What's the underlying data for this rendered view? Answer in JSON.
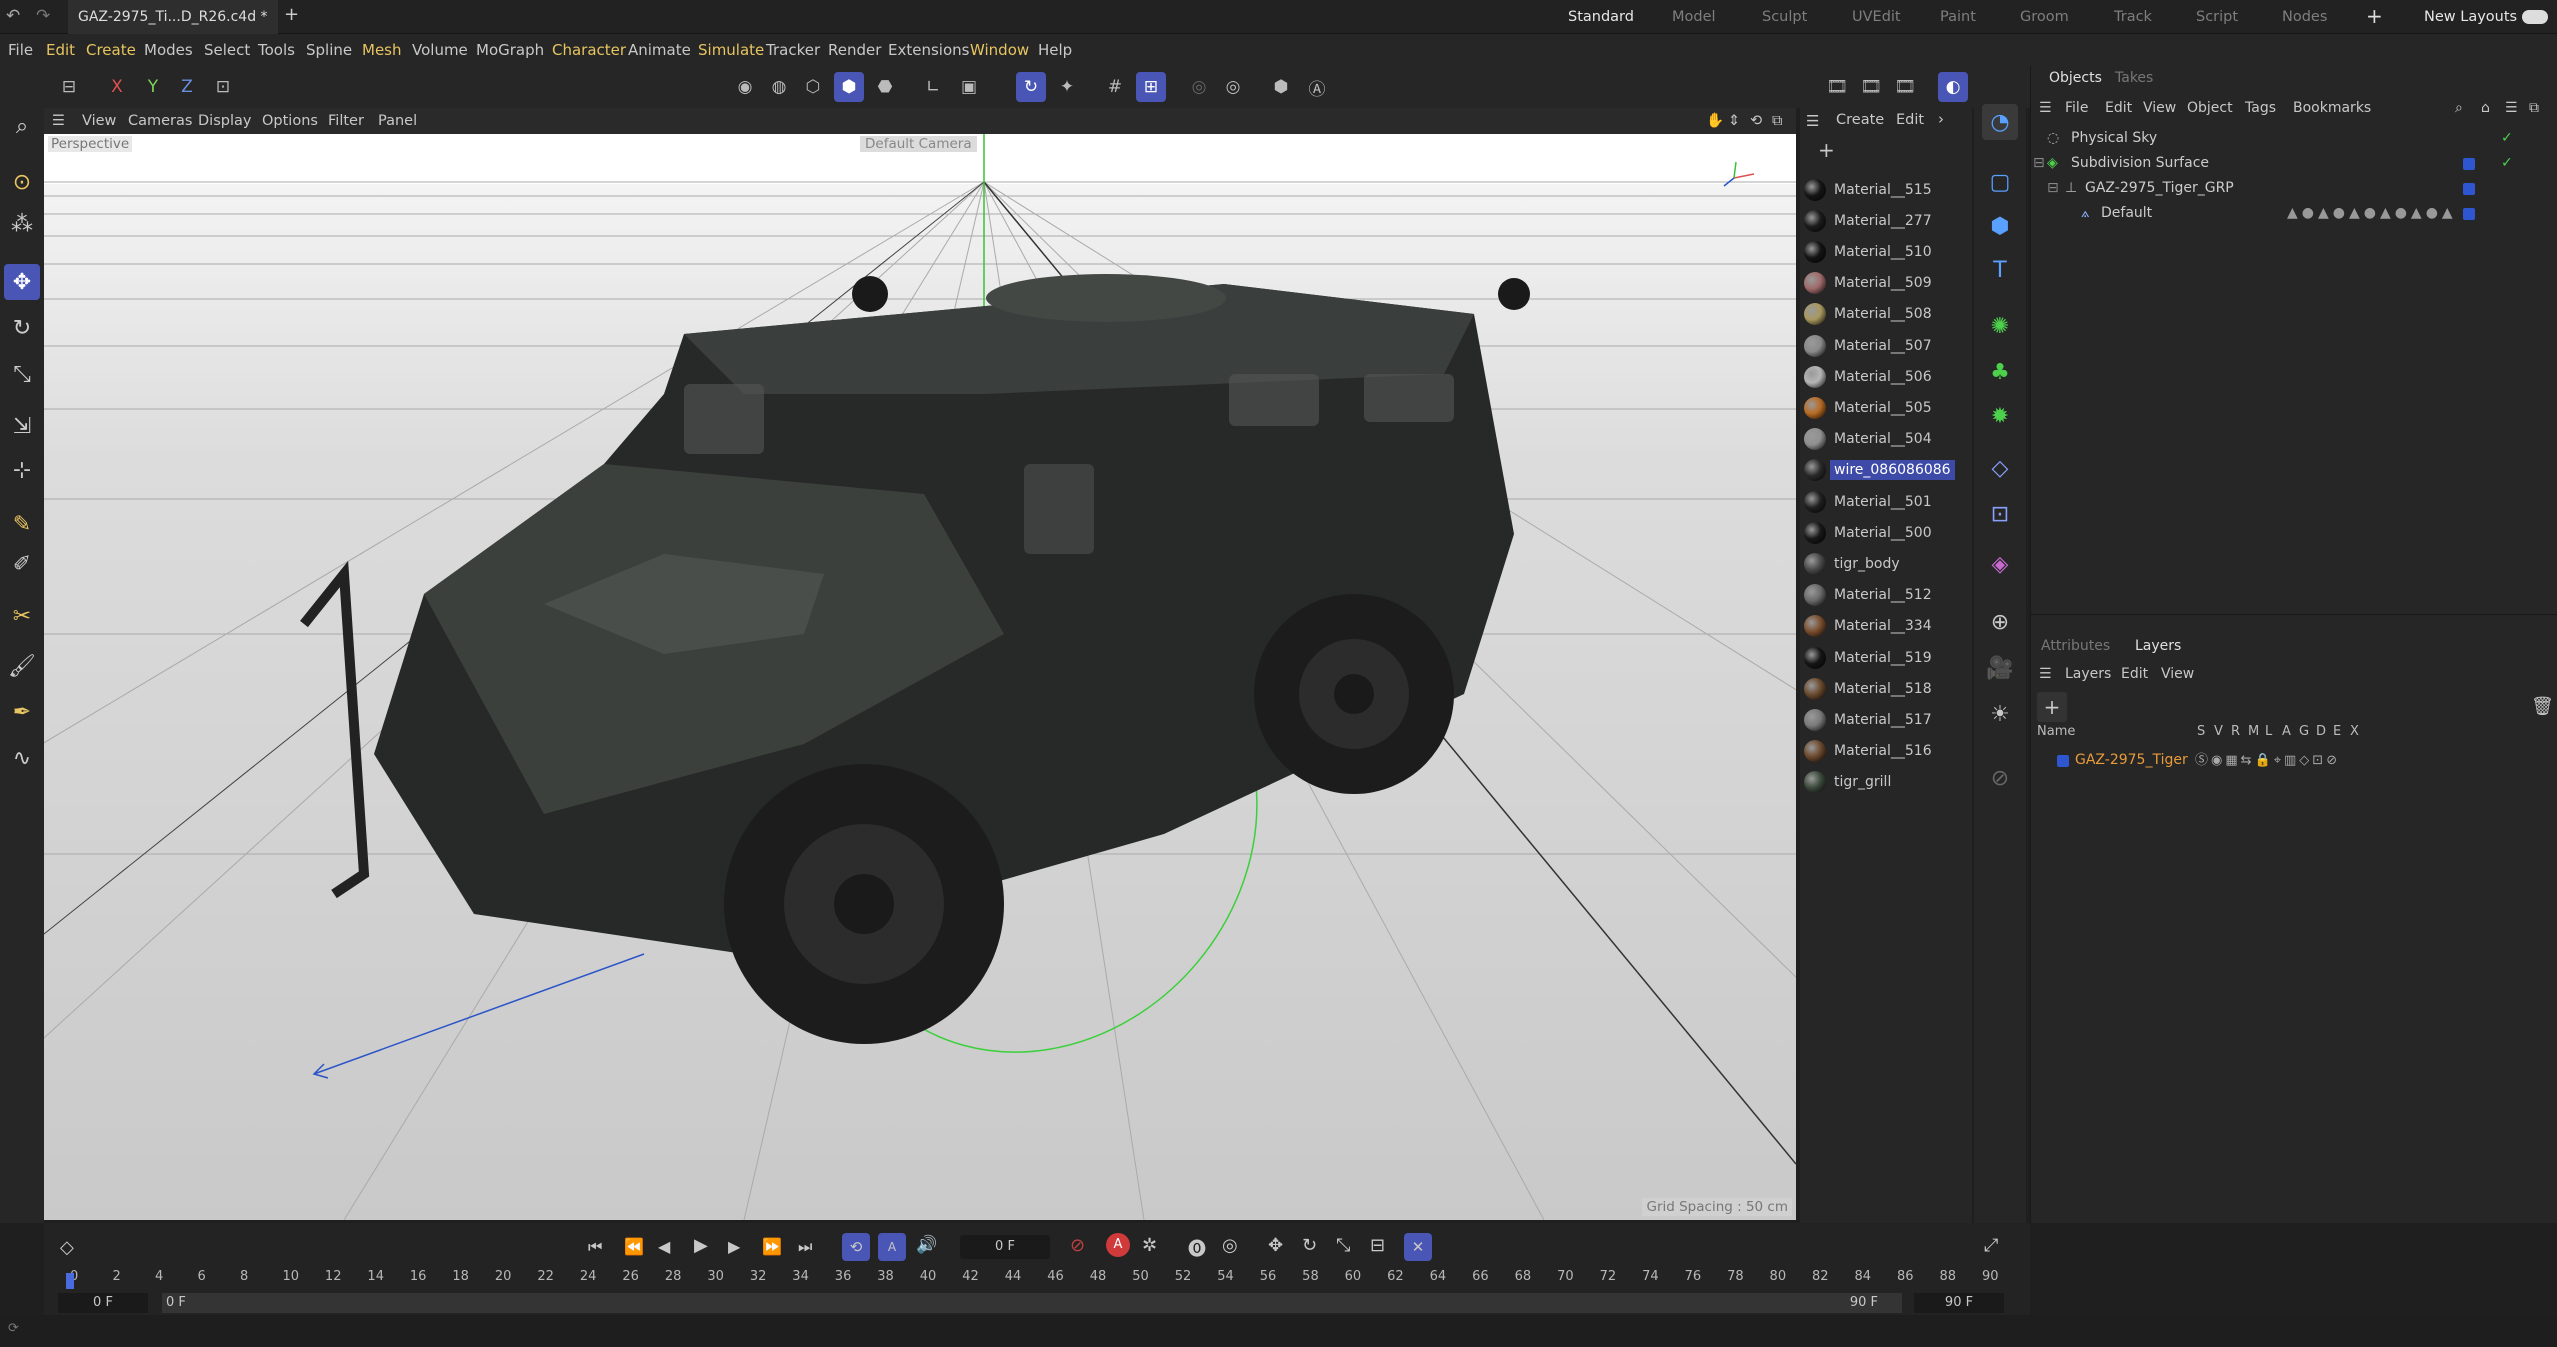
{
  "window": {
    "doc_tab": "GAZ-2975_Ti...D_R26.c4d *",
    "new_tab": "+"
  },
  "layouts": [
    "Standard",
    "Model",
    "Sculpt",
    "UVEdit",
    "Paint",
    "Groom",
    "Track",
    "Script",
    "Nodes"
  ],
  "active_layout": "Standard",
  "new_layouts_label": "New Layouts",
  "menus": [
    "File",
    "Edit",
    "Create",
    "Modes",
    "Select",
    "Tools",
    "Spline",
    "Mesh",
    "Volume",
    "MoGraph",
    "Character",
    "Animate",
    "Simulate",
    "Tracker",
    "Render",
    "Extensions",
    "Window",
    "Help"
  ],
  "axis_toggles": [
    "X",
    "Y",
    "Z"
  ],
  "viewport": {
    "menus": [
      "View",
      "Cameras",
      "Display",
      "Options",
      "Filter",
      "Panel"
    ],
    "projection": "Perspective",
    "camera": "Default Camera",
    "grid_spacing": "Grid Spacing : 50 cm"
  },
  "material_panel": {
    "menus": [
      "Create",
      "Edit"
    ],
    "materials": [
      {
        "name": "Material__515",
        "color": "#161616"
      },
      {
        "name": "Material__277",
        "color": "#1b1b1b"
      },
      {
        "name": "Material__510",
        "color": "#141414"
      },
      {
        "name": "Material__509",
        "color": "#a06a6a"
      },
      {
        "name": "Material__508",
        "color": "#a8985e"
      },
      {
        "name": "Material__507",
        "color": "#8a8a8a"
      },
      {
        "name": "Material__506",
        "color": "#b5b5b5"
      },
      {
        "name": "Material__505",
        "color": "#b86a22"
      },
      {
        "name": "Material__504",
        "color": "#909090"
      },
      {
        "name": "wire_086086086",
        "color": "#2a2a2a",
        "selected": true
      },
      {
        "name": "Material__501",
        "color": "#202020"
      },
      {
        "name": "Material__500",
        "color": "#181818"
      },
      {
        "name": "tigr_body",
        "color": "#4a4a4a"
      },
      {
        "name": "Material__512",
        "color": "#6a6a6a"
      },
      {
        "name": "Material__334",
        "color": "#7a4e2e"
      },
      {
        "name": "Material__519",
        "color": "#151515"
      },
      {
        "name": "Material__518",
        "color": "#6a4a2e"
      },
      {
        "name": "Material__517",
        "color": "#7a7a7a"
      },
      {
        "name": "Material__516",
        "color": "#6d4a2e"
      },
      {
        "name": "tigr_grill",
        "color": "#3c4a3c"
      }
    ]
  },
  "objects_panel": {
    "tabs": [
      "Objects",
      "Takes"
    ],
    "active_tab": "Objects",
    "menus": [
      "File",
      "Edit",
      "View",
      "Object",
      "Tags",
      "Bookmarks"
    ],
    "tree": [
      {
        "name": "Physical Sky",
        "depth": 0,
        "check": true
      },
      {
        "name": "Subdivision Surface",
        "depth": 0,
        "check": true
      },
      {
        "name": "GAZ-2975_Tiger_GRP",
        "depth": 1,
        "check": false
      },
      {
        "name": "Default",
        "depth": 2,
        "check": false
      }
    ]
  },
  "layers_panel": {
    "tabs": [
      "Attributes",
      "Layers"
    ],
    "active_tab": "Layers",
    "menus": [
      "Layers",
      "Edit",
      "View"
    ],
    "columns": [
      "Name",
      "S",
      "V",
      "R",
      "M",
      "L",
      "A",
      "G",
      "D",
      "E",
      "X"
    ],
    "layers": [
      {
        "name": "GAZ-2975_Tiger",
        "color": "#2e56d0"
      }
    ]
  },
  "timeline": {
    "current_frame": "0 F",
    "start_frame": "0 F",
    "range_start": "0 F",
    "range_end": "90 F",
    "end_frame": "90 F",
    "ticks": [
      "0",
      "2",
      "4",
      "6",
      "8",
      "10",
      "12",
      "14",
      "16",
      "18",
      "20",
      "22",
      "24",
      "26",
      "28",
      "30",
      "32",
      "34",
      "36",
      "38",
      "40",
      "42",
      "44",
      "46",
      "48",
      "50",
      "52",
      "54",
      "56",
      "58",
      "60",
      "62",
      "64",
      "66",
      "68",
      "70",
      "72",
      "74",
      "76",
      "78",
      "80",
      "82",
      "84",
      "86",
      "88",
      "90"
    ]
  },
  "colors": {
    "accent": "#4a56b5",
    "highlight": "#e7c560",
    "check": "#4dd14d",
    "layer_name": "#e79b3a"
  }
}
